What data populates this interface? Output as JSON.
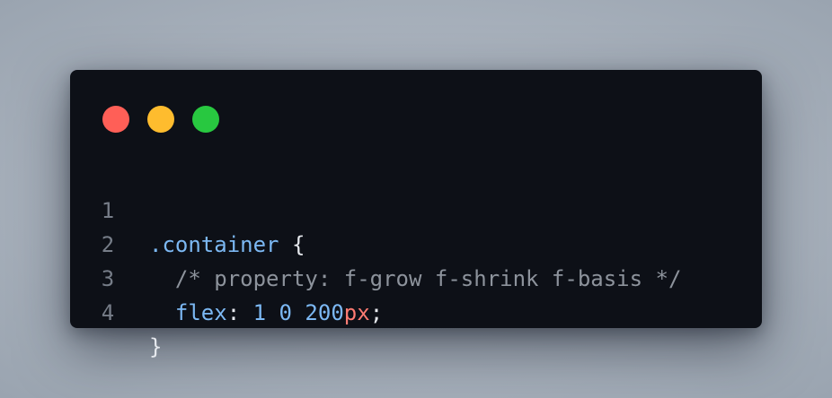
{
  "window": {
    "controls": [
      {
        "name": "close",
        "color": "#ff5f57"
      },
      {
        "name": "minimize",
        "color": "#febc2e"
      },
      {
        "name": "maximize",
        "color": "#28c840"
      }
    ]
  },
  "code": {
    "lines": [
      {
        "number": "1",
        "selector": ".container",
        "brace": "{"
      },
      {
        "number": "2",
        "comment": "/* property: f-grow f-shrink f-basis */"
      },
      {
        "number": "3",
        "property": "flex",
        "colon": ":",
        "v1": "1",
        "v2": "0",
        "v3": "200",
        "unit": "px",
        "semicolon": ";"
      },
      {
        "number": "4",
        "brace": "}"
      }
    ]
  },
  "colors": {
    "window_bg": "#0d1017",
    "selector": "#7cb8f3",
    "comment": "#8d939c",
    "unit": "#ff7b72",
    "line_number": "#767d88"
  }
}
